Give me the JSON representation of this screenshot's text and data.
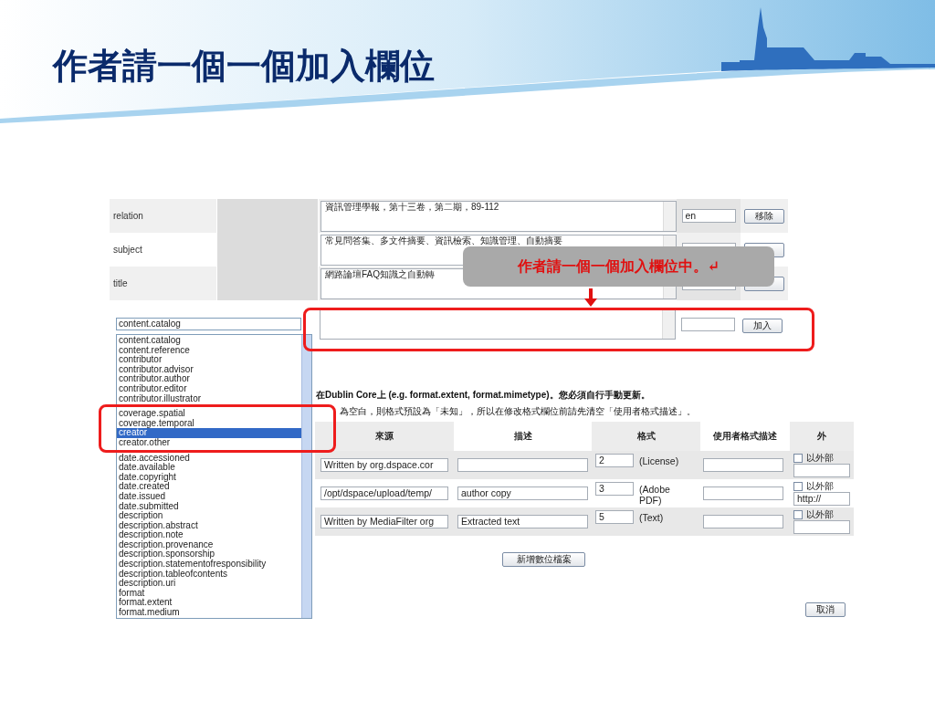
{
  "slide_title": "作者請一個一個加入欄位",
  "metadata_rows": [
    {
      "field": "relation",
      "value": "資訊管理學報，第十三卷，第二期，89-112",
      "language": "en",
      "button": "移除"
    },
    {
      "field": "subject",
      "value": "常見問答集、多文件摘要、資訊檢索、知識管理、自動摘要"
    },
    {
      "field": "title",
      "value": "網路論壇FAQ知識之自動轉"
    }
  ],
  "new_field": {
    "select_value": "content.catalog",
    "add_button": "加入"
  },
  "field_options": [
    {
      "label": "content.catalog",
      "selected": false
    },
    {
      "label": "content.reference",
      "selected": false
    },
    {
      "label": "contributor",
      "selected": false
    },
    {
      "label": "contributor.advisor",
      "selected": false
    },
    {
      "label": "contributor.author",
      "selected": false
    },
    {
      "label": "contributor.editor",
      "selected": false
    },
    {
      "label": "contributor.illustrator",
      "selected": false
    },
    {
      "label": "coverage.spatial",
      "selected": false,
      "highlighted": true
    },
    {
      "label": "coverage.temporal",
      "selected": false,
      "highlighted": true
    },
    {
      "label": "creator",
      "selected": true,
      "highlighted": true
    },
    {
      "label": "creator.other",
      "selected": false,
      "highlighted": true
    },
    {
      "label": "date.accessioned",
      "selected": false
    },
    {
      "label": "date.available",
      "selected": false
    },
    {
      "label": "date.copyright",
      "selected": false
    },
    {
      "label": "date.created",
      "selected": false
    },
    {
      "label": "date.issued",
      "selected": false
    },
    {
      "label": "date.submitted",
      "selected": false
    },
    {
      "label": "description",
      "selected": false
    },
    {
      "label": "description.abstract",
      "selected": false
    },
    {
      "label": "description.note",
      "selected": false
    },
    {
      "label": "description.provenance",
      "selected": false
    },
    {
      "label": "description.sponsorship",
      "selected": false
    },
    {
      "label": "description.statementofresponsibility",
      "selected": false
    },
    {
      "label": "description.tableofcontents",
      "selected": false
    },
    {
      "label": "description.uri",
      "selected": false
    },
    {
      "label": "format",
      "selected": false
    },
    {
      "label": "format.extent",
      "selected": false
    },
    {
      "label": "format.medium",
      "selected": false
    }
  ],
  "notes": [
    "在Dublin Core上 (e.g. format.extent, format.mimetype)。您必須自行手動更新。",
    "為空白，則格式預設為「未知」，所以在修改格式欄位前請先清空「使用者格式描述」。"
  ],
  "file_table": {
    "columns": [
      "來源",
      "描述",
      "格式",
      "使用者格式描述",
      "外"
    ],
    "rows": [
      {
        "source": "Written by org.dspace.cor",
        "description": "",
        "format_id": "2",
        "format_name": "(License)",
        "user_format": "",
        "external_label": "以外部",
        "external_checked": false,
        "external_url": ""
      },
      {
        "source": "/opt/dspace/upload/temp/",
        "description": "author copy",
        "format_id": "3",
        "format_name": "(Adobe PDF)",
        "user_format": "",
        "external_label": "以外部",
        "external_checked": false,
        "external_url": "http://"
      },
      {
        "source": "Written by MediaFilter org",
        "description": "Extracted text",
        "format_id": "5",
        "format_name": "(Text)",
        "user_format": "",
        "external_label": "以外部",
        "external_checked": false,
        "external_url": ""
      }
    ]
  },
  "add_file_button": "新增數位檔案",
  "cancel_button": "取消",
  "callout": "作者請一個一個加入欄位中。↵"
}
